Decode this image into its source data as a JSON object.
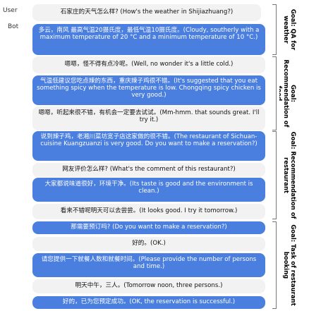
{
  "speakers": {
    "user": "User",
    "bot": "Bot"
  },
  "messages": [
    {
      "role": "user",
      "text": "石家庄的天气怎么样? (How's the weather in Shijiazhuang?)"
    },
    {
      "role": "bot",
      "text": "多云，南风 最高气温20摄氏度，最低气温10摄氏度。(Cloudy, southerly with a maximum temperature of 20 °C and a minimum temperature of 10 °C.)"
    },
    {
      "role": "user",
      "text": "嗯嗯，怪不得有点冷呢。(Well, no wonder it's a little cold.)"
    },
    {
      "role": "bot",
      "text": "气温低建议您吃点辣的东西，重庆辣子鸡很不错。(It's suggested that you eat something spicy when the temperature is low. Chongqing spicy chicken is very good.)"
    },
    {
      "role": "user",
      "text": "嗯嗯，听起来很不错，有机会一定要去试试。(Mm-hmm. that sounds great. I'll try it.)"
    },
    {
      "role": "bot",
      "text": "说到辣子鸡，老湘川菜坊宽子店这家做的很不错。(The restaurant of Sichuan-cuisine Kuangzuanzi is very good. Do you want to make a reservation?)"
    },
    {
      "role": "user",
      "text": "网友评价怎么样? (What's the comment of this restaurant?)"
    },
    {
      "role": "bot",
      "text": "大家都说味道很好，环境干净。(Its taste is good and the environment is clean.)"
    },
    {
      "role": "user",
      "text": "看来不错呢明天可以去尝尝。(It looks good. I try it tomorrow.)"
    },
    {
      "role": "bot",
      "text": "那需要预订吗? (Do you want to make a reservation?)"
    },
    {
      "role": "user",
      "text": "好的。(OK.)"
    },
    {
      "role": "bot",
      "text": "请您提供一下就餐人数和就餐时间。(Please provide the number of persons and time.)"
    },
    {
      "role": "user",
      "text": "明天中午，三人。(Tomorrow noon, three persons.)"
    },
    {
      "role": "bot",
      "text": "好的，已为您预定成功。(OK, the reservation is successful.)"
    }
  ],
  "goals": [
    "Goal: QA for weather",
    "Goal: Recommendation of food",
    "Goal: Recommendation of restaurant",
    "Goal: Task of restaurant booking"
  ]
}
